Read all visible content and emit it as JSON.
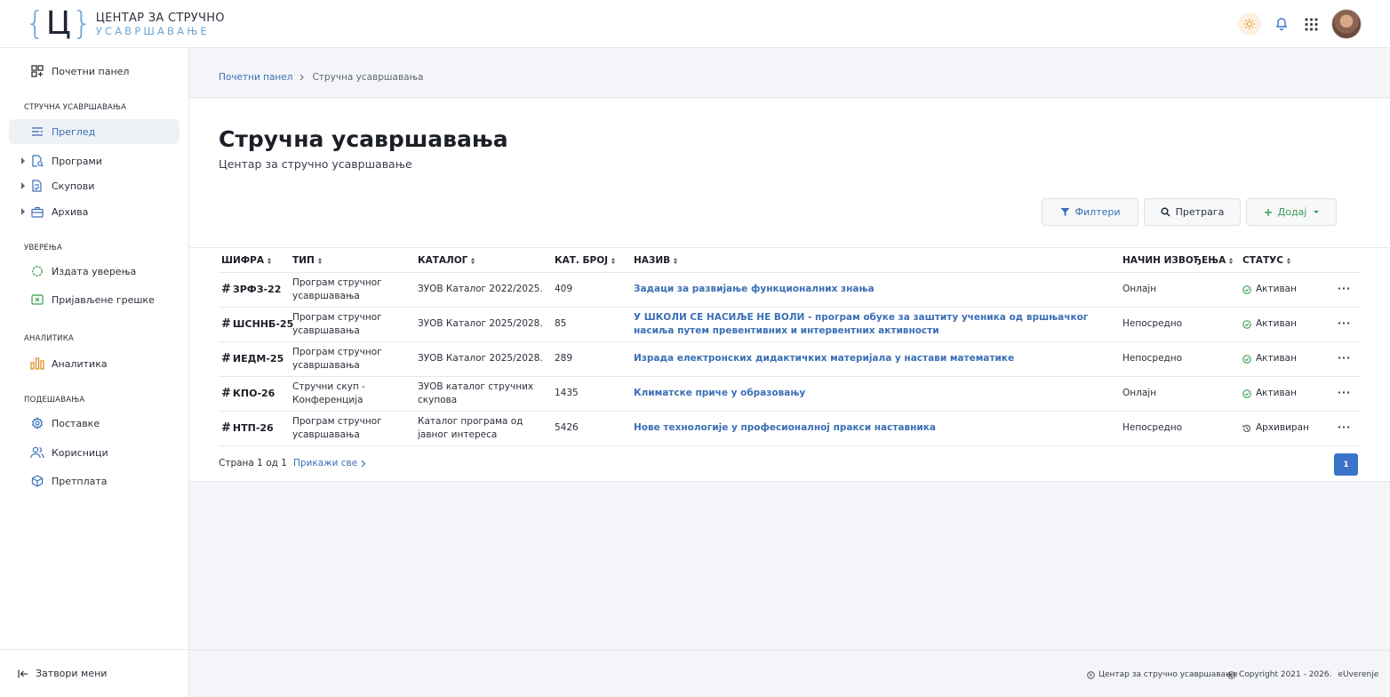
{
  "logo": {
    "brace_open": "{",
    "letter": "Ц",
    "brace_close": "}",
    "line1": "ЦЕНТАР ЗА СТРУЧНО",
    "line2": "УСАВРШАВАЊЕ"
  },
  "sidebar": {
    "dashboard": "Почетни панел",
    "section1": "СТРУЧНА УСАВРШАВАЊА",
    "overview": "Преглед",
    "programs": "Програми",
    "gatherings": "Скупови",
    "archive": "Архива",
    "section2": "УВЕРЕЊА",
    "issued": "Издата уверења",
    "reported_errors": "Пријављене грешке",
    "section3": "АНАЛИТИКА",
    "analytics": "Аналитика",
    "section4": "ПОДЕШАВАЊА",
    "settings": "Поставке",
    "users": "Корисници",
    "subscription": "Претплата",
    "close_menu": "Затвори мени"
  },
  "breadcrumb": {
    "home": "Почетни панел",
    "current": "Стручна усавршавања"
  },
  "page": {
    "title": "Стручна усавршавања",
    "subtitle": "Центар за стручно усавршавање"
  },
  "toolbar": {
    "filters": "Филтери",
    "search": "Претрага",
    "add": "Додај"
  },
  "table": {
    "headers": {
      "code": "ШИФРА",
      "type": "ТИП",
      "catalog": "КАТАЛОГ",
      "cat_num": "КАТ. БРОЈ",
      "name": "НАЗИВ",
      "mode": "НАЧИН ИЗВОЂЕЊА",
      "status": "СТАТУС"
    },
    "rows": [
      {
        "code": "ЗРФЗ-22",
        "type": "Програм стручног усавршавања",
        "catalog": "ЗУОВ Каталог 2022/2025.",
        "num": "409",
        "name": "Задаци за развијање функционалних знања",
        "mode": "Онлајн",
        "status": "Активан"
      },
      {
        "code": "ШСННБ-25",
        "type": "Програм стручног усавршавања",
        "catalog": "ЗУОВ Каталог 2025/2028.",
        "num": "85",
        "name": "У ШКОЛИ СЕ НАСИЉЕ НЕ ВОЛИ - програм обуке за заштиту ученика од вршњачког насиља путем превентивних и интервентних активности",
        "mode": "Непосредно",
        "status": "Активан"
      },
      {
        "code": "ИЕДМ-25",
        "type": "Програм стручног усавршавања",
        "catalog": "ЗУОВ Каталог 2025/2028.",
        "num": "289",
        "name": "Израда електронских дидактичких материјала у настави математике",
        "mode": "Непосредно",
        "status": "Активан"
      },
      {
        "code": "КПО-26",
        "type": "Стручни скуп - Конференција",
        "catalog": "ЗУОВ каталог стручних скупова",
        "num": "1435",
        "name": "Климатске приче у образовању",
        "mode": "Онлајн",
        "status": "Активан"
      },
      {
        "code": "НТП-26",
        "type": "Програм стручног усавршавања",
        "catalog": "Каталог програма од јавног интереса",
        "num": "5426",
        "name": "Нове технологије у професионалној пракси наставника",
        "mode": "Непосредно",
        "status": "Архивиран"
      }
    ],
    "hash": "#",
    "more": "···"
  },
  "pagination": {
    "text": "Страна 1 од 1",
    "show_all": "Прикажи све",
    "page": "1"
  },
  "footer": {
    "org": "Центар за стручно усавршавање",
    "copyright": "Copyright 2021 - 2026.",
    "brand": "eUverenje"
  },
  "colors": {
    "accent": "#3a6fb5",
    "active": "#3a9a4a",
    "logo_blue": "#6aa6d8"
  }
}
